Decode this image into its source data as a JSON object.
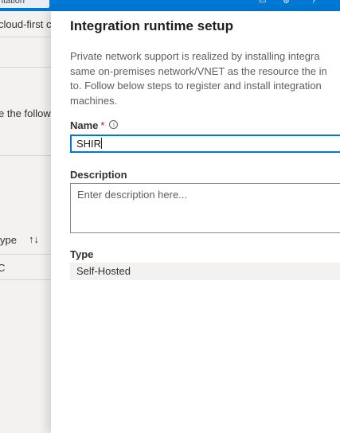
{
  "topbar": {
    "tab_label": "ntation"
  },
  "left": {
    "cloud_first": "cloud-first c",
    "follow_text": "e the follow",
    "type_header": "ype",
    "sort_glyph": "↑↓",
    "row_value": "C"
  },
  "panel": {
    "title": "Integration runtime setup",
    "description_lines": [
      "Private network support is realized by installing integra",
      "same on-premises network/VNET as the resource the in",
      "to. Follow below steps to register and install integration",
      "machines."
    ],
    "name": {
      "label": "Name",
      "required_mark": "*",
      "info_glyph": "i",
      "value": "SHIR"
    },
    "description": {
      "label": "Description",
      "placeholder": "Enter description here..."
    },
    "type": {
      "label": "Type",
      "value": "Self-Hosted"
    }
  },
  "colors": {
    "accent": "#0078d4",
    "required": "#a4262c",
    "panel_gray": "#f3f2f1"
  }
}
